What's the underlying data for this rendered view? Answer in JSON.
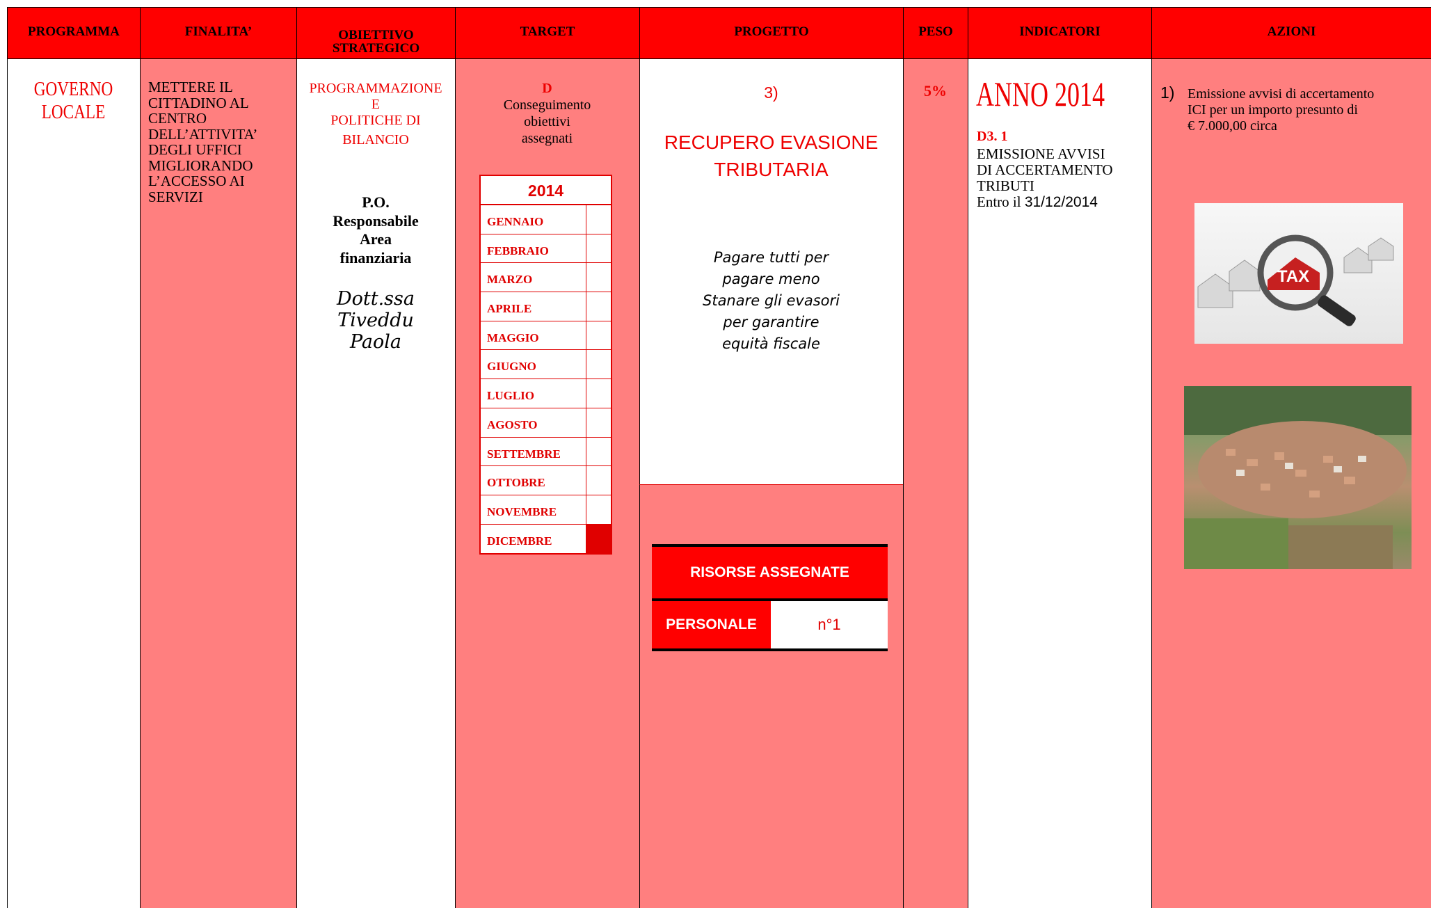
{
  "headers": {
    "programma": "PROGRAMMA",
    "finalita": "FINALITA’",
    "obiettivo": "OBIETTIVO STRATEGICO",
    "target": "TARGET",
    "progetto": "PROGETTO",
    "peso": "PESO",
    "indicatori": "INDICATORI",
    "azioni": "AZIONI"
  },
  "programma": {
    "line1": "GOVERNO",
    "line2": "LOCALE"
  },
  "finalita": {
    "lines": [
      "METTERE IL",
      "CITTADINO AL",
      "CENTRO",
      "DELL’ATTIVITA’",
      "DEGLI UFFICI",
      "MIGLIORANDO",
      "L’ACCESSO AI",
      "SERVIZI"
    ]
  },
  "obiettivo": {
    "lines": [
      "PROGRAMMAZIONE",
      "E",
      "POLITICHE DI",
      "BILANCIO"
    ],
    "po_lines": [
      "P.O.",
      "Responsabile",
      "Area",
      "finanziaria"
    ],
    "sign_lines": [
      "Dott.ssa",
      "Tiveddu",
      "Paola"
    ]
  },
  "target": {
    "letter": "D",
    "lines": [
      "Conseguimento",
      "obiettivi",
      "assegnati"
    ],
    "year": "2014",
    "months": [
      "GENNAIO",
      "FEBBRAIO",
      "MARZO",
      "APRILE",
      "MAGGIO",
      "GIUGNO",
      "LUGLIO",
      "AGOSTO",
      "SETTEMBRE",
      "OTTOBRE",
      "NOVEMBRE",
      "DICEMBRE"
    ],
    "filled_month": "DICEMBRE"
  },
  "progetto": {
    "number": "3)",
    "title_lines": [
      "RECUPERO EVASIONE",
      "TRIBUTARIA"
    ],
    "motto_lines": [
      "Pagare tutti per",
      "pagare meno",
      "Stanare gli evasori",
      "per garantire",
      "equità  fiscale"
    ],
    "risorse_title": "RISORSE ASSEGNATE",
    "personale_label": "PERSONALE",
    "personale_value": "n°1"
  },
  "peso": "5%",
  "indicatori": {
    "anno": "ANNO 2014",
    "code": "D3. 1",
    "lines": [
      "EMISSIONE AVVISI",
      "DI ACCERTAMENTO",
      "TRIBUTI"
    ],
    "entro_label": "Entro il ",
    "entro_date": "31/12/2014"
  },
  "azioni": {
    "num": "1)",
    "lines": [
      "Emissione avvisi di accertamento",
      "ICI per un importo presunto di",
      "€ 7.000,00 circa"
    ],
    "image1_text": "TAX"
  }
}
